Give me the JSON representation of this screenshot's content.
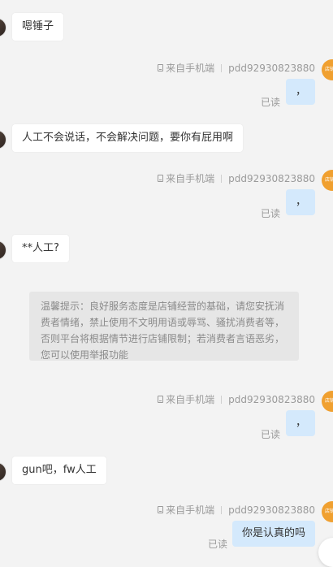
{
  "seller": {
    "meta_source": "来自手机端",
    "username": "pdd92930823880",
    "avatar_text": "店铺",
    "read_label": "已读"
  },
  "messages": [
    {
      "side": "in",
      "text": "嗯锤子"
    },
    {
      "side": "out",
      "text": "，"
    },
    {
      "side": "in",
      "text": "人工不会说话，不会解决问题，要你有屁用啊"
    },
    {
      "side": "out",
      "text": "，"
    },
    {
      "side": "in",
      "text": "**人工?"
    },
    {
      "side": "out",
      "text": "，"
    },
    {
      "side": "in",
      "text": "gun吧，fw人工"
    },
    {
      "side": "out",
      "text": "你是认真的吗"
    }
  ],
  "notice": {
    "text": "温馨提示：良好服务态度是店铺经营的基础，请您安抚消费者情绪，禁止使用不文明用语或辱骂、骚扰消费者等，否则平台将根据情节进行店铺限制；若消费者言语恶劣，您可以使用举报功能"
  },
  "colors": {
    "background": "#f3f3f3",
    "incoming_bubble": "#ffffff",
    "outgoing_bubble": "#d4e9fc",
    "notice_bg": "#e6e6e6",
    "seller_avatar": "#f0a030"
  }
}
